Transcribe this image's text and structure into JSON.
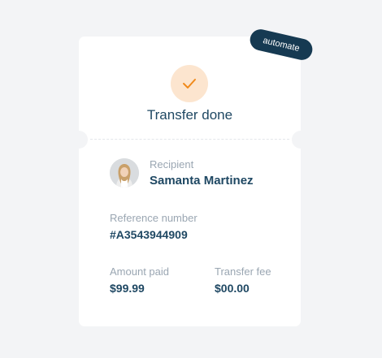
{
  "badge": {
    "label": "automate"
  },
  "status": {
    "title": "Transfer done",
    "icon": "checkmark-icon"
  },
  "recipient": {
    "label": "Recipient",
    "name": "Samanta Martinez"
  },
  "reference": {
    "label": "Reference number",
    "value": "#A3543944909"
  },
  "amount": {
    "label": "Amount paid",
    "value": "$99.99"
  },
  "fee": {
    "label": "Transfer fee",
    "value": "$00.00"
  },
  "colors": {
    "accent": "#f08a1c",
    "accent_bg": "#fce5cf",
    "text_primary": "#1f4863",
    "text_muted": "#9aa6b2",
    "badge_bg": "#163a52"
  }
}
